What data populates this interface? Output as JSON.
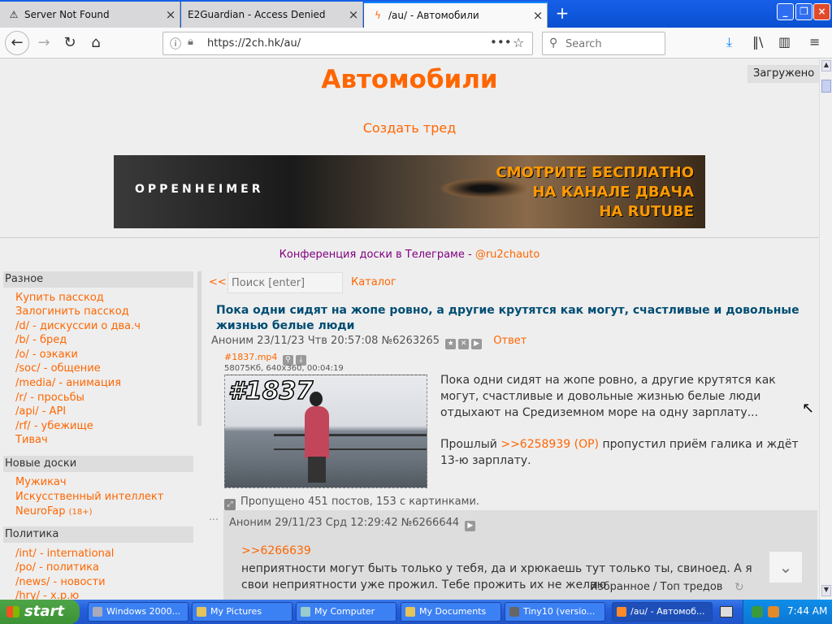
{
  "browser": {
    "tabs": [
      {
        "title": "Server Not Found",
        "icon": "warning-icon"
      },
      {
        "title": "E2Guardian - Access Denied",
        "icon": ""
      },
      {
        "title": "/au/ - Автомобили",
        "icon": "lightning-icon"
      }
    ],
    "url": "https://2ch.hk/au/",
    "search_placeholder": "Search",
    "new_tab_glyph": "+"
  },
  "page": {
    "loaded_tooltip": "Загружено",
    "board_title": "Автомобили",
    "create_thread": "Создать тред",
    "banner": {
      "left_text": "OPPENHEIMER",
      "right_line1": "СМОТРИТЕ БЕСПЛАТНО",
      "right_line2": "НА КАНАЛЕ ДВАЧА",
      "right_line3": "НА RUTUBE"
    },
    "telegram_text": "Конференция доски в Телеграме - ",
    "telegram_link": "@ru2chauto",
    "sidebar": {
      "sections": [
        {
          "title": "Разное",
          "items": [
            "Купить пасскод",
            "Залогинить пасскод",
            "/d/ - дискуссии о два.ч",
            "/b/ - бред",
            "/o/ - оэкаки",
            "/soc/ - общение",
            "/media/ - анимация",
            "/r/ - просьбы",
            "/api/ - API",
            "/rf/ - убежище",
            "Тивач"
          ]
        },
        {
          "title": "Новые доски",
          "items": [
            "Мужикач",
            "Искусственный интеллект",
            "NeuroFap"
          ],
          "badge": "(18+)"
        },
        {
          "title": "Политика",
          "items": [
            "/int/ - international",
            "/po/ - политика",
            "/news/ - новости",
            "/hry/ - х.р.ю"
          ]
        }
      ]
    },
    "controls": {
      "back": "<<",
      "search_placeholder": "Поиск [enter]",
      "catalog": "Каталог"
    },
    "op": {
      "subject": "Пока одни сидят на жопе ровно, а другие крутятся как могут, счастливые и довольные жизнью белые люди",
      "author": "Аноним",
      "date": "23/11/23 Чтв 20:57:08",
      "number": "№6263265",
      "reply_label": "Ответ",
      "file_name": "#1837.mp4",
      "file_info": "58075Кб, 640x360, 00:04:19",
      "thumb_label": "#1837",
      "text_para1": "Пока одни сидят на жопе ровно, а другие крутятся как могут, счастливые и довольные жизнью белые люди отдыхают на Средиземном море на одну зарплату...",
      "text_para2_prefix": "Прошлый ",
      "text_para2_ref": ">>6258939 (OP)",
      "text_para2_suffix": " пропустил приём галика и ждёт 13-ю зарплату.",
      "omitted": "Пропущено 451 постов, 153 с картинками."
    },
    "reply": {
      "meta": "Аноним 29/11/23 Срд 12:29:42 №6266644",
      "ref": ">>6266639",
      "text": "неприятности могут быть только у тебя, да и хрюкаешь тут только ты, свиноед. А я свои неприятности уже прожил. Тебе прожить их не желаю"
    },
    "footer": {
      "favorites": "Избранное",
      "separator": "/",
      "top_threads": "Топ тредов"
    }
  },
  "taskbar": {
    "start_label": "start",
    "buttons": [
      "Windows 2000...",
      "My Pictures",
      "My Computer",
      "My Documents",
      "Tiny10 (versio...",
      "/au/ - Автомоб..."
    ],
    "time": "7:44 AM"
  },
  "colors": {
    "accent": "#ff6600",
    "subject": "#004d73",
    "xp_blue": "#245edb"
  }
}
